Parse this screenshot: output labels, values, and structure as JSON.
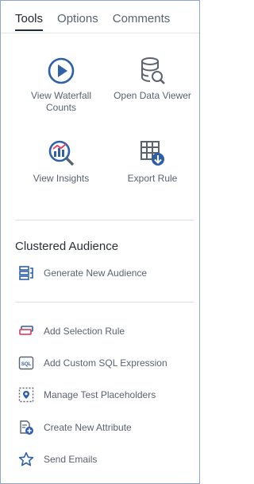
{
  "tabs": [
    {
      "label": "Tools",
      "active": true
    },
    {
      "label": "Options",
      "active": false
    },
    {
      "label": "Comments",
      "active": false
    }
  ],
  "tools": {
    "view_waterfall_counts": "View Waterfall Counts",
    "open_data_viewer": "Open Data Viewer",
    "view_insights": "View Insights",
    "export_rule": "Export Rule"
  },
  "section": {
    "title": "Clustered Audience",
    "generate_new_audience": "Generate New Audience"
  },
  "actions": {
    "add_selection_rule": "Add Selection Rule",
    "add_custom_sql_expression": "Add Custom SQL Expression",
    "manage_test_placeholders": "Manage Test Placeholders",
    "create_new_attribute": "Create New Attribute",
    "send_emails": "Send Emails"
  },
  "colors": {
    "accent_blue": "#2f5fa8",
    "icon_gray": "#5b6270",
    "selection_pink": "#e0496b"
  },
  "icons": [
    "play-circle-icon",
    "database-search-icon",
    "analytics-search-icon",
    "table-export-icon",
    "layers-list-icon",
    "tag-stack-icon",
    "sql-icon",
    "placeholder-pin-icon",
    "attribute-add-icon",
    "star-icon"
  ]
}
